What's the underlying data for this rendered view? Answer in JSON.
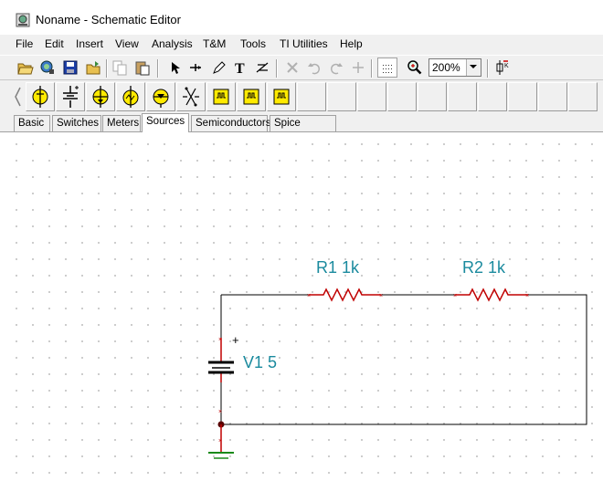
{
  "window": {
    "title": "Noname - Schematic Editor",
    "app_icon": "tina-app-icon"
  },
  "menu": [
    "File",
    "Edit",
    "Insert",
    "View",
    "Analysis",
    "T&M",
    "Tools",
    "TI Utilities",
    "Help"
  ],
  "toolbar": {
    "zoom_value": "200%",
    "buttons": [
      "open-icon",
      "library-icon",
      "save-icon",
      "open-folder-icon",
      "copy-icon",
      "paste-icon",
      "select-arrow-icon",
      "wire-icon",
      "pen-icon",
      "text-icon",
      "label-icon",
      "delete-icon",
      "undo-icon",
      "redo-icon",
      "crosshair-icon",
      "grid-icon",
      "zoom-icon",
      "component-icon"
    ]
  },
  "component_tabs": [
    "Basic",
    "Switches",
    "Meters",
    "Sources",
    "Semiconductors",
    "Spice Macros"
  ],
  "active_tab": "Sources",
  "schematic": {
    "r1_label": "R1 1k",
    "r2_label": "R2 1k",
    "v1_label": "V1 5",
    "plus_sign": "+",
    "wire_color": "#000000",
    "component_color": "#c00000",
    "label_color": "#1a8a9e"
  }
}
